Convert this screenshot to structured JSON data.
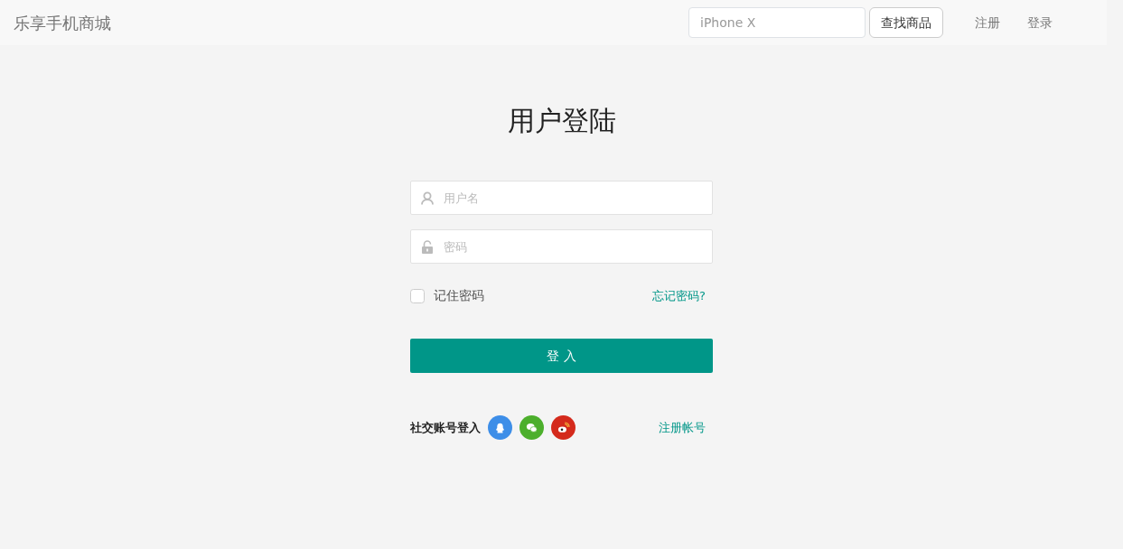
{
  "navbar": {
    "brand": "乐享手机商城",
    "search": {
      "placeholder": "iPhone X"
    },
    "search_button": "查找商品",
    "links": [
      "注册",
      "登录"
    ]
  },
  "login": {
    "title": "用户登陆",
    "username": {
      "placeholder": "用户名"
    },
    "password": {
      "placeholder": "密码"
    },
    "remember": {
      "label": "记住密码",
      "checked": false
    },
    "forgot": "忘记密码?",
    "submit": "登 入",
    "social": {
      "label": "社交账号登入",
      "providers": [
        {
          "kind": "qq",
          "color": "#3d8ee8"
        },
        {
          "kind": "wechat",
          "color": "#4caf2c"
        },
        {
          "kind": "weibo",
          "color": "#d42a1c"
        }
      ]
    },
    "register": "注册帐号"
  }
}
